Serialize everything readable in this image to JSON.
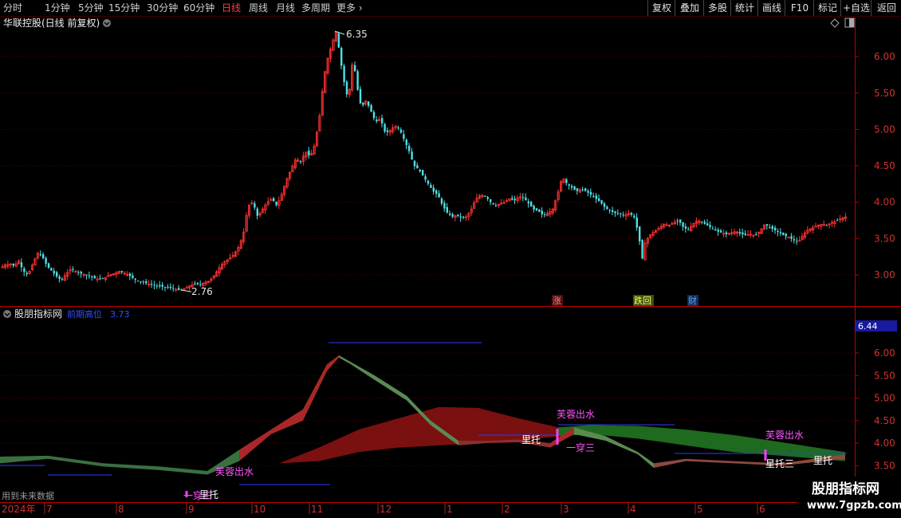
{
  "toolbar": {
    "timeframes": [
      "分时",
      "1分钟",
      "5分钟",
      "15分钟",
      "30分钟",
      "60分钟",
      "日线",
      "周线",
      "月线",
      "多周期",
      "更多"
    ],
    "active": "日线",
    "buttons": [
      "复权",
      "叠加",
      "多股",
      "统计",
      "画线",
      "F10",
      "标记",
      "+自选",
      "返回"
    ]
  },
  "colors": {
    "up": "#ff3232",
    "down": "#4fe0e8",
    "grid": "#5a0000",
    "axis": "#c00000",
    "signal": "#ff3cff",
    "blueLine": "#2a3cff"
  },
  "main_pane": {
    "title": "华联控股(日线 前复权)",
    "price_labels": [
      "6.00",
      "5.50",
      "5.00",
      "4.50",
      "4.00",
      "3.50",
      "3.00"
    ],
    "high_label": "6.35",
    "low_label": "2.76",
    "event_markers": [
      "涨",
      "跌回",
      "财"
    ]
  },
  "indicator_pane": {
    "name": "股朋指标网",
    "series_name": "前期高位",
    "series_value": "3.73",
    "current_value": "6.44",
    "price_labels": [
      "6.00",
      "5.50",
      "5.00",
      "4.50",
      "4.00",
      "3.50"
    ],
    "signals": [
      "芙蓉出水",
      "里托",
      "一穿三",
      "里托",
      "芙蓉出水",
      "一穿三",
      "芙蓉出水",
      "星托三",
      "里托"
    ],
    "watermark_left": "用到未来数据",
    "watermark_right_title": "股朋指标网",
    "watermark_right_url": "www.7gpzb.com"
  },
  "date_axis": {
    "year_label": "2024年",
    "months": [
      "7",
      "8",
      "9",
      "10",
      "11",
      "12",
      "1",
      "2",
      "3",
      "4",
      "5",
      "6"
    ]
  },
  "chart_data": {
    "type": "candlestick",
    "title": "华联控股(日线 前复权)",
    "y_range": [
      2.6,
      6.55
    ],
    "x_labels": [
      "2024年",
      "7",
      "8",
      "9",
      "10",
      "11",
      "12",
      "1",
      "2",
      "3",
      "4",
      "5",
      "6"
    ],
    "close_path": [
      [
        0,
        3.1
      ],
      [
        6,
        3.14
      ],
      [
        12,
        3.15
      ],
      [
        17,
        3.12
      ],
      [
        22,
        3.2
      ],
      [
        28,
        3.05
      ],
      [
        34,
        3.0
      ],
      [
        40,
        3.15
      ],
      [
        46,
        3.3
      ],
      [
        52,
        3.25
      ],
      [
        58,
        3.12
      ],
      [
        64,
        3.05
      ],
      [
        70,
        2.98
      ],
      [
        76,
        2.92
      ],
      [
        82,
        3.02
      ],
      [
        88,
        3.08
      ],
      [
        94,
        3.05
      ],
      [
        100,
        3.02
      ],
      [
        106,
        3.0
      ],
      [
        112,
        2.98
      ],
      [
        118,
        2.95
      ],
      [
        124,
        2.94
      ],
      [
        130,
        2.96
      ],
      [
        136,
        3.0
      ],
      [
        142,
        3.02
      ],
      [
        148,
        3.05
      ],
      [
        154,
        3.03
      ],
      [
        160,
        3.0
      ],
      [
        166,
        2.95
      ],
      [
        172,
        2.92
      ],
      [
        178,
        2.9
      ],
      [
        184,
        2.88
      ],
      [
        190,
        2.86
      ],
      [
        196,
        2.85
      ],
      [
        202,
        2.84
      ],
      [
        208,
        2.83
      ],
      [
        214,
        2.82
      ],
      [
        220,
        2.8
      ],
      [
        226,
        2.79
      ],
      [
        232,
        2.82
      ],
      [
        238,
        2.86
      ],
      [
        244,
        2.88
      ],
      [
        250,
        2.87
      ],
      [
        256,
        2.9
      ],
      [
        262,
        2.92
      ],
      [
        268,
        3.0
      ],
      [
        274,
        3.1
      ],
      [
        280,
        3.18
      ],
      [
        286,
        3.22
      ],
      [
        292,
        3.28
      ],
      [
        298,
        3.38
      ],
      [
        304,
        3.55
      ],
      [
        310,
        3.95
      ],
      [
        316,
        4.0
      ],
      [
        322,
        3.8
      ],
      [
        328,
        3.9
      ],
      [
        334,
        4.0
      ],
      [
        340,
        4.05
      ],
      [
        346,
        3.95
      ],
      [
        352,
        4.1
      ],
      [
        358,
        4.3
      ],
      [
        364,
        4.45
      ],
      [
        370,
        4.6
      ],
      [
        376,
        4.55
      ],
      [
        382,
        4.7
      ],
      [
        388,
        4.62
      ],
      [
        394,
        4.8
      ],
      [
        400,
        5.2
      ],
      [
        404,
        5.6
      ],
      [
        408,
        5.9
      ],
      [
        412,
        6.05
      ],
      [
        416,
        6.2
      ],
      [
        420,
        6.35
      ],
      [
        424,
        6.1
      ],
      [
        428,
        5.8
      ],
      [
        432,
        5.55
      ],
      [
        436,
        5.4
      ],
      [
        440,
        5.9
      ],
      [
        444,
        5.8
      ],
      [
        448,
        5.5
      ],
      [
        452,
        5.3
      ],
      [
        458,
        5.4
      ],
      [
        464,
        5.25
      ],
      [
        470,
        5.1
      ],
      [
        476,
        5.15
      ],
      [
        482,
        4.95
      ],
      [
        488,
        4.98
      ],
      [
        494,
        5.05
      ],
      [
        500,
        5.0
      ],
      [
        506,
        4.85
      ],
      [
        512,
        4.7
      ],
      [
        518,
        4.5
      ],
      [
        524,
        4.45
      ],
      [
        530,
        4.35
      ],
      [
        536,
        4.25
      ],
      [
        542,
        4.15
      ],
      [
        548,
        4.1
      ],
      [
        554,
        3.95
      ],
      [
        560,
        3.85
      ],
      [
        566,
        3.8
      ],
      [
        572,
        3.82
      ],
      [
        578,
        3.78
      ],
      [
        584,
        3.8
      ],
      [
        590,
        3.9
      ],
      [
        596,
        4.05
      ],
      [
        602,
        4.1
      ],
      [
        608,
        4.08
      ],
      [
        614,
        4.0
      ],
      [
        620,
        3.95
      ],
      [
        626,
        3.98
      ],
      [
        632,
        4.0
      ],
      [
        638,
        4.05
      ],
      [
        644,
        4.02
      ],
      [
        650,
        4.08
      ],
      [
        656,
        4.05
      ],
      [
        662,
        3.98
      ],
      [
        668,
        3.9
      ],
      [
        674,
        3.88
      ],
      [
        680,
        3.82
      ],
      [
        686,
        3.85
      ],
      [
        692,
        3.9
      ],
      [
        698,
        4.1
      ],
      [
        704,
        4.35
      ],
      [
        710,
        4.25
      ],
      [
        716,
        4.2
      ],
      [
        722,
        4.15
      ],
      [
        728,
        4.18
      ],
      [
        734,
        4.15
      ],
      [
        740,
        4.1
      ],
      [
        746,
        4.05
      ],
      [
        752,
        4.0
      ],
      [
        758,
        3.92
      ],
      [
        764,
        3.88
      ],
      [
        770,
        3.85
      ],
      [
        776,
        3.84
      ],
      [
        782,
        3.82
      ],
      [
        788,
        3.85
      ],
      [
        794,
        3.8
      ],
      [
        800,
        3.55
      ],
      [
        804,
        3.2
      ],
      [
        808,
        3.45
      ],
      [
        814,
        3.55
      ],
      [
        820,
        3.6
      ],
      [
        826,
        3.65
      ],
      [
        832,
        3.7
      ],
      [
        838,
        3.68
      ],
      [
        844,
        3.72
      ],
      [
        850,
        3.75
      ],
      [
        856,
        3.65
      ],
      [
        862,
        3.62
      ],
      [
        868,
        3.7
      ],
      [
        874,
        3.75
      ],
      [
        880,
        3.72
      ],
      [
        886,
        3.68
      ],
      [
        892,
        3.64
      ],
      [
        898,
        3.6
      ],
      [
        904,
        3.58
      ],
      [
        910,
        3.56
      ],
      [
        916,
        3.58
      ],
      [
        922,
        3.6
      ],
      [
        928,
        3.56
      ],
      [
        934,
        3.55
      ],
      [
        940,
        3.56
      ],
      [
        946,
        3.54
      ],
      [
        952,
        3.6
      ],
      [
        958,
        3.7
      ],
      [
        964,
        3.65
      ],
      [
        970,
        3.62
      ],
      [
        976,
        3.58
      ],
      [
        982,
        3.54
      ],
      [
        988,
        3.52
      ],
      [
        994,
        3.48
      ],
      [
        1000,
        3.45
      ],
      [
        1006,
        3.55
      ],
      [
        1012,
        3.62
      ],
      [
        1018,
        3.65
      ],
      [
        1024,
        3.68
      ],
      [
        1030,
        3.7
      ],
      [
        1036,
        3.68
      ],
      [
        1042,
        3.72
      ],
      [
        1048,
        3.74
      ],
      [
        1054,
        3.78
      ],
      [
        1060,
        3.8
      ]
    ],
    "indicator_fast_band": [
      [
        0,
        3.55,
        3.7
      ],
      [
        60,
        3.65,
        3.72
      ],
      [
        130,
        3.48,
        3.55
      ],
      [
        200,
        3.4,
        3.48
      ],
      [
        260,
        3.3,
        3.38
      ],
      [
        300,
        3.6,
        3.85
      ],
      [
        340,
        4.2,
        4.3
      ],
      [
        380,
        4.5,
        4.75
      ],
      [
        410,
        5.6,
        5.75
      ],
      [
        425,
        5.9,
        5.95
      ],
      [
        440,
        5.75,
        5.8
      ],
      [
        470,
        5.4,
        5.5
      ],
      [
        510,
        4.95,
        5.05
      ],
      [
        540,
        4.4,
        4.5
      ],
      [
        575,
        3.95,
        4.05
      ],
      [
        610,
        4.0,
        4.05
      ],
      [
        650,
        4.02,
        4.08
      ],
      [
        690,
        3.9,
        4.0
      ],
      [
        720,
        4.2,
        4.35
      ],
      [
        760,
        4.05,
        4.15
      ],
      [
        800,
        3.75,
        3.8
      ],
      [
        820,
        3.45,
        3.55
      ],
      [
        860,
        3.6,
        3.65
      ],
      [
        920,
        3.55,
        3.6
      ],
      [
        980,
        3.5,
        3.55
      ],
      [
        1060,
        3.65,
        3.75
      ]
    ],
    "indicator_slow_band": [
      [
        280,
        3.25,
        3.25
      ],
      [
        350,
        3.55,
        3.55
      ],
      [
        400,
        3.6,
        3.9
      ],
      [
        450,
        3.8,
        4.3
      ],
      [
        500,
        3.9,
        4.55
      ],
      [
        550,
        3.95,
        4.8
      ],
      [
        600,
        4.0,
        4.78
      ],
      [
        650,
        4.05,
        4.55
      ],
      [
        700,
        4.15,
        4.35
      ],
      [
        740,
        4.2,
        4.4
      ],
      [
        800,
        4.1,
        4.38
      ],
      [
        860,
        3.95,
        4.3
      ],
      [
        920,
        3.8,
        4.18
      ],
      [
        980,
        3.72,
        4.02
      ],
      [
        1060,
        3.6,
        3.8
      ]
    ]
  }
}
